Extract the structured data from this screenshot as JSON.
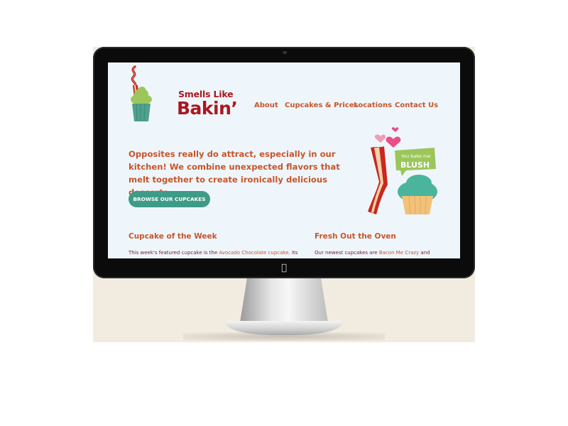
{
  "brand": {
    "name_line1": "Smells Like",
    "name_line2": "Bakin’"
  },
  "nav": {
    "items": [
      {
        "label": "About"
      },
      {
        "label": "Cupcakes & Prices"
      },
      {
        "label": "Locations"
      },
      {
        "label": "Contact Us"
      }
    ]
  },
  "hero": {
    "headline": "Opposites really do attract, especially in our kitchen! We combine unexpected flavors that melt together to create ironically delicious desserts.",
    "cta_label": "BROWSE OUR CUPCAKES",
    "illustration_badge_line1": "You bake me",
    "illustration_badge_line2": "BLUSH"
  },
  "sections": {
    "week": {
      "title": "Cupcake of the Week",
      "body_pre": "This week's featured cupcake is the ",
      "body_link": "Avocado Chocolate cupcake",
      "body_post": ". Its strange"
    },
    "fresh": {
      "title": "Fresh Out the Oven",
      "body_pre": "Our newest cupcakes are ",
      "body_link": "Bacon Me Crazy",
      "body_post": " and"
    }
  },
  "colors": {
    "accent_orange": "#c7552a",
    "brand_red": "#a8191f",
    "button_teal": "#3e9b88",
    "screen_bg": "#eef6fc"
  },
  "icons": [
    "apple-logo-icon",
    "cupcake-logo-icon",
    "bacon-icon",
    "heart-icon"
  ]
}
